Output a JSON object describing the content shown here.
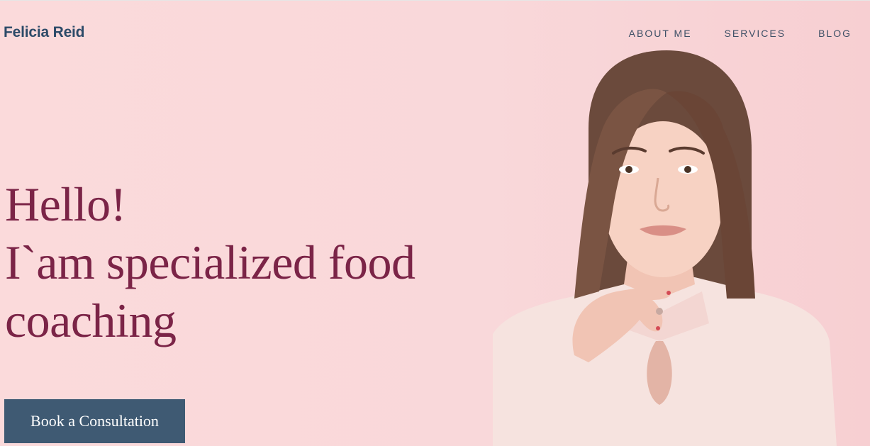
{
  "header": {
    "brand": "Felicia Reid",
    "nav": [
      "ABOUT ME",
      "SERVICES",
      "BLOG"
    ]
  },
  "hero": {
    "line1": "Hello!",
    "line2": "I`am specialized food",
    "line3": "coaching",
    "cta_label": "Book a Consultation"
  },
  "colors": {
    "background": "#fadcdd",
    "brand": "#2c4a68",
    "headline": "#7b2447",
    "button": "#3f5a73"
  }
}
